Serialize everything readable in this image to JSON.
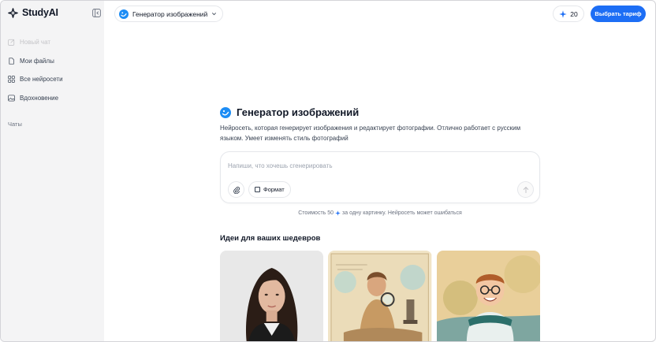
{
  "app": {
    "name": "StudyAI"
  },
  "sidebar": {
    "items": [
      {
        "label": "Новый чат",
        "icon": "edit-icon",
        "disabled": true
      },
      {
        "label": "Мои файлы",
        "icon": "file-icon",
        "disabled": false
      },
      {
        "label": "Все нейросети",
        "icon": "grid-icon",
        "disabled": false
      },
      {
        "label": "Вдохновение",
        "icon": "image-icon",
        "disabled": false
      }
    ],
    "section_label": "Чаты"
  },
  "header": {
    "model_label": "Генератор изображений",
    "credits": "20",
    "plan_button": "Выбрать тариф"
  },
  "main": {
    "title": "Генератор изображений",
    "description": "Нейросеть, которая генерирует изображения и редактирует фотографии. Отлично работает с русским языком. Умеет изменять стиль фотографий",
    "composer": {
      "placeholder": "Напиши, что хочешь сгенерировать",
      "format_label": "Формат"
    },
    "cost_note": {
      "prefix": "Стоимость 50",
      "suffix": "за одну картинку. Нейросеть может ошибаться"
    },
    "ideas_title": "Идеи для ваших шедевров",
    "ideas": [
      {
        "style": "portrait-photo"
      },
      {
        "style": "watercolor-scientist"
      },
      {
        "style": "cartoon-boy"
      }
    ]
  },
  "colors": {
    "accent": "#1d6ef5",
    "sidebar_bg": "#f4f4f5"
  }
}
